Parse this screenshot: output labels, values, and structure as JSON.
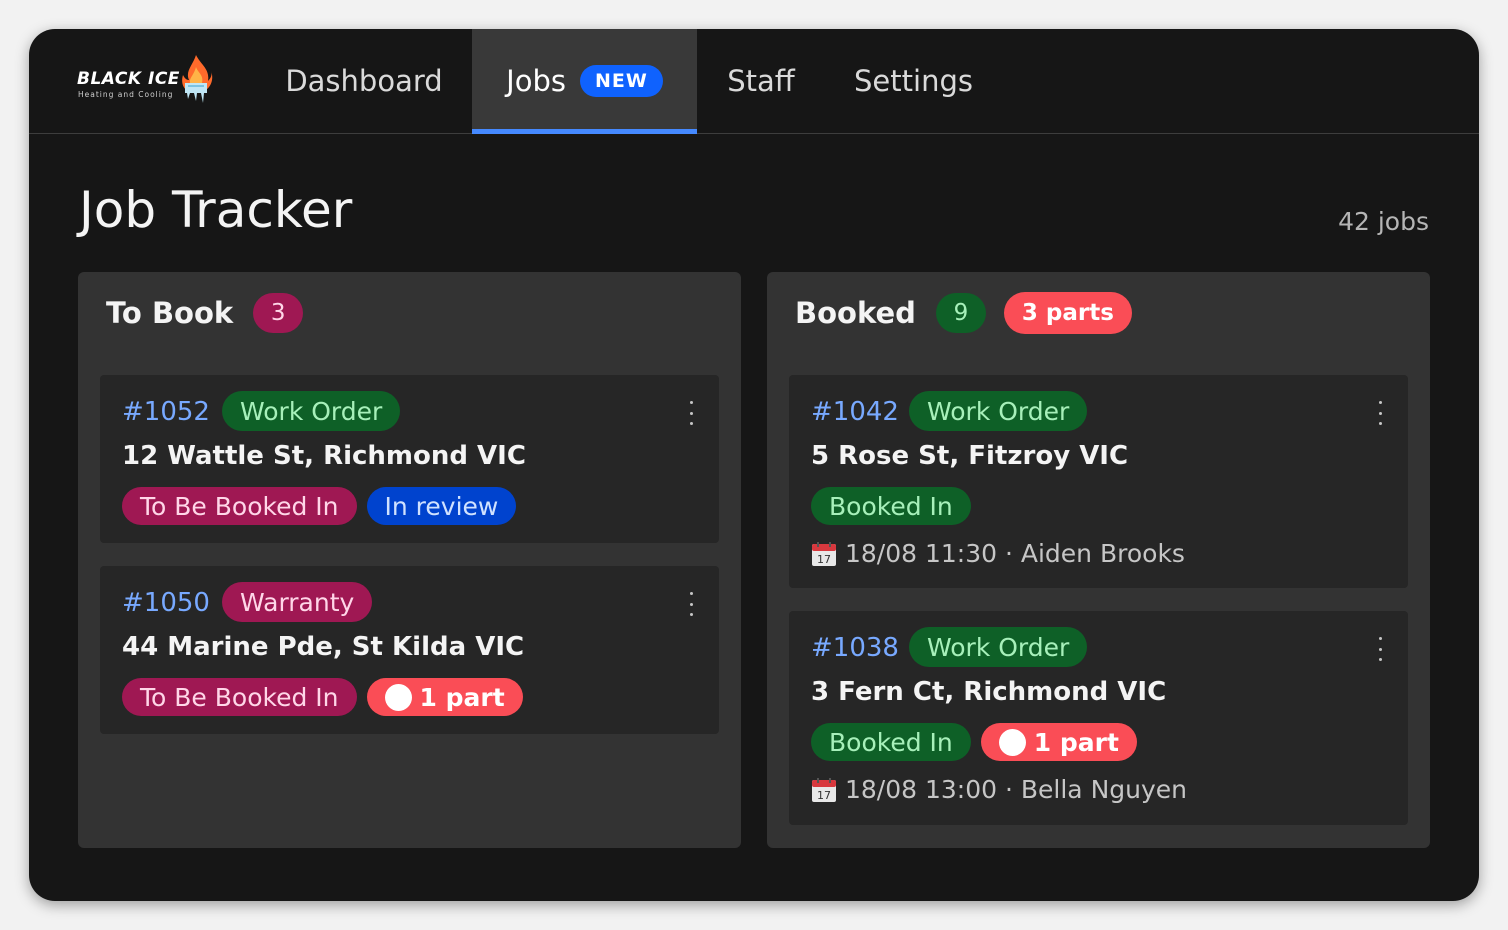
{
  "nav": {
    "logo_text": "BLACK ICE",
    "logo_sub": "Heating and Cooling",
    "tabs": [
      {
        "label": "Dashboard"
      },
      {
        "label": "Jobs",
        "badge": "NEW"
      },
      {
        "label": "Staff"
      },
      {
        "label": "Settings"
      }
    ],
    "active_tab": "Jobs"
  },
  "page": {
    "title": "Job Tracker",
    "job_count": "42 jobs"
  },
  "columns": [
    {
      "title": "To Book",
      "count": "3",
      "cards": [
        {
          "id": "#1052",
          "type": "Work Order",
          "address": "12 Wattle St, Richmond VIC",
          "tags": [
            "To Be Booked In",
            "In review"
          ]
        },
        {
          "id": "#1050",
          "type": "Warranty",
          "address": "44 Marine Pde, St Kilda VIC",
          "tags": [
            "To Be Booked In"
          ],
          "parts": "1 part"
        }
      ]
    },
    {
      "title": "Booked",
      "count": "9",
      "parts": "3 parts",
      "cards": [
        {
          "id": "#1042",
          "type": "Work Order",
          "address": "5 Rose St, Fitzroy VIC",
          "tags": [
            "Booked In"
          ],
          "booking": "18/08 11:30 · Aiden Brooks"
        },
        {
          "id": "#1038",
          "type": "Work Order",
          "address": "3 Fern Ct, Richmond VIC",
          "tags": [
            "Booked In"
          ],
          "parts": "1 part",
          "booking": "18/08 13:00 · Bella Nguyen"
        }
      ]
    }
  ],
  "icons": {
    "calendar": "calendar-icon",
    "kebab": "kebab-menu-icon",
    "logo": "flame-ice-logo"
  },
  "colors": {
    "accent": "#4589ff",
    "new_badge": "#0f62fe",
    "pink_tag": "#9f1853",
    "green_tag": "#0e6027",
    "blue_tag": "#0043ce",
    "parts_red": "#fa4d56",
    "id_blue": "#78a9ff"
  }
}
